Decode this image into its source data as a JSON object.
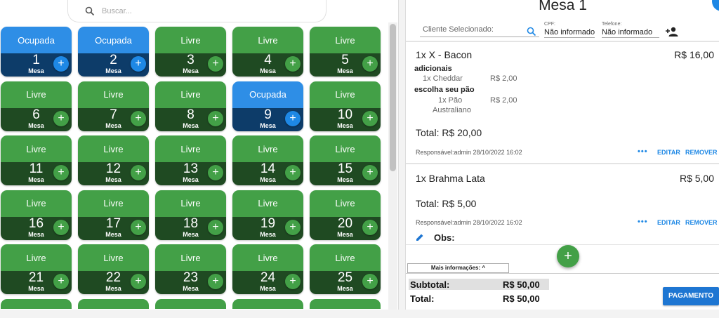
{
  "search": {
    "placeholder": "Buscar..."
  },
  "colors": {
    "free_top": "#43a047",
    "free_bottom": "#1f4a22",
    "busy_top": "#2e8ee6",
    "busy_bottom": "#0d3c69",
    "accent": "#1e88e5"
  },
  "table_label": "Mesa",
  "add_icon": "+",
  "tables": [
    {
      "number": "1",
      "status": "Ocupada",
      "busy": true
    },
    {
      "number": "2",
      "status": "Ocupada",
      "busy": true
    },
    {
      "number": "3",
      "status": "Livre",
      "busy": false
    },
    {
      "number": "4",
      "status": "Livre",
      "busy": false
    },
    {
      "number": "5",
      "status": "Livre",
      "busy": false
    },
    {
      "number": "6",
      "status": "Livre",
      "busy": false
    },
    {
      "number": "7",
      "status": "Livre",
      "busy": false
    },
    {
      "number": "8",
      "status": "Livre",
      "busy": false
    },
    {
      "number": "9",
      "status": "Ocupada",
      "busy": true
    },
    {
      "number": "10",
      "status": "Livre",
      "busy": false
    },
    {
      "number": "11",
      "status": "Livre",
      "busy": false
    },
    {
      "number": "12",
      "status": "Livre",
      "busy": false
    },
    {
      "number": "13",
      "status": "Livre",
      "busy": false
    },
    {
      "number": "14",
      "status": "Livre",
      "busy": false
    },
    {
      "number": "15",
      "status": "Livre",
      "busy": false
    },
    {
      "number": "16",
      "status": "Livre",
      "busy": false
    },
    {
      "number": "17",
      "status": "Livre",
      "busy": false
    },
    {
      "number": "18",
      "status": "Livre",
      "busy": false
    },
    {
      "number": "19",
      "status": "Livre",
      "busy": false
    },
    {
      "number": "20",
      "status": "Livre",
      "busy": false
    },
    {
      "number": "21",
      "status": "Livre",
      "busy": false
    },
    {
      "number": "22",
      "status": "Livre",
      "busy": false
    },
    {
      "number": "23",
      "status": "Livre",
      "busy": false
    },
    {
      "number": "24",
      "status": "Livre",
      "busy": false
    },
    {
      "number": "25",
      "status": "Livre",
      "busy": false
    }
  ],
  "order": {
    "title": "Mesa 1",
    "client_label": "Cliente Selecionado:",
    "cpf_label": "CPF:",
    "cpf_value": "Não informado",
    "phone_label": "Telefone:",
    "phone_value": "Não informado",
    "items": [
      {
        "name": "1x X - Bacon",
        "price": "R$ 16,00",
        "group1": "adicionais",
        "g1_item": "1x Cheddar",
        "g1_price": "R$ 2,00",
        "group2": "escolha seu pão",
        "g2_item_l1": "1x Pão",
        "g2_item_l2": "Australiano",
        "g2_price": "R$ 2,00",
        "total": "Total: R$ 20,00",
        "meta": "Responsável:admin  28/10/2022 16:02",
        "more": "•••",
        "edit": "EDITAR",
        "remove": "REMOVER"
      },
      {
        "name": "1x Brahma Lata",
        "price": "R$ 5,00",
        "total": "Total: R$ 5,00",
        "meta": "Responsável:admin  28/10/2022 16:02",
        "more": "•••",
        "edit": "EDITAR",
        "remove": "REMOVER"
      }
    ],
    "obs_label": "Obs:",
    "more_info": "Mais informações: ^",
    "subtotal_label": "Subtotal:",
    "subtotal_value": "R$ 50,00",
    "total_label": "Total:",
    "total_value": "R$ 50,00",
    "pay_label": "PAGAMENTO"
  }
}
